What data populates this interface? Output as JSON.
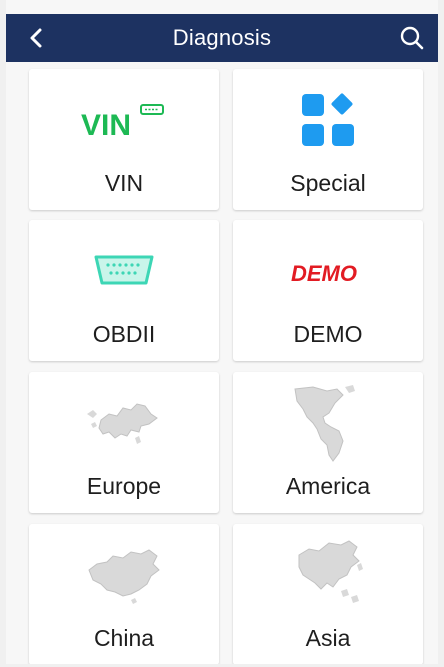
{
  "header": {
    "title": "Diagnosis",
    "back_icon": "chevron-left-icon",
    "search_icon": "search-icon",
    "background": "#1d3261"
  },
  "tiles": [
    {
      "label": "VIN",
      "icon_text": "VIN",
      "icon": "vin-icon",
      "accent": "#1db954"
    },
    {
      "label": "Special",
      "icon": "special-grid-icon",
      "accent": "#1e9bf0"
    },
    {
      "label": "OBDII",
      "icon": "obd-connector-icon",
      "accent": "#3dd6b5"
    },
    {
      "label": "DEMO",
      "icon_text": "DEMO",
      "icon": "demo-icon",
      "accent": "#e21b23"
    },
    {
      "label": "Europe",
      "icon": "europe-map-icon"
    },
    {
      "label": "America",
      "icon": "america-map-icon"
    },
    {
      "label": "China",
      "icon": "china-map-icon"
    },
    {
      "label": "Asia",
      "icon": "asia-map-icon"
    }
  ]
}
